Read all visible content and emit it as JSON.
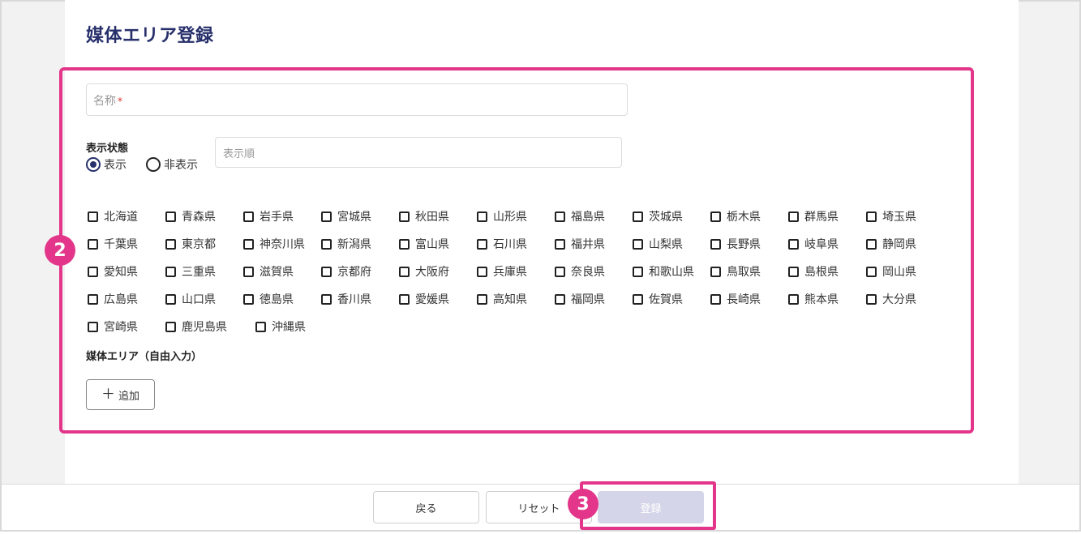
{
  "page": {
    "title": "媒体エリア登録"
  },
  "form": {
    "name_placeholder": "名称",
    "required_mark": "*",
    "status_label": "表示状態",
    "status_options": [
      "表示",
      "非表示"
    ],
    "status_selected": "表示",
    "order_placeholder": "表示順",
    "prefecture_rows": [
      [
        "北海道",
        "青森県",
        "岩手県",
        "宮城県",
        "秋田県",
        "山形県",
        "福島県",
        "茨城県",
        "栃木県",
        "群馬県",
        "埼玉県"
      ],
      [
        "千葉県",
        "東京都",
        "神奈川県",
        "新潟県",
        "富山県",
        "石川県",
        "福井県",
        "山梨県",
        "長野県",
        "岐阜県",
        "静岡県"
      ],
      [
        "愛知県",
        "三重県",
        "滋賀県",
        "京都府",
        "大阪府",
        "兵庫県",
        "奈良県",
        "和歌山県",
        "鳥取県",
        "島根県",
        "岡山県"
      ],
      [
        "広島県",
        "山口県",
        "徳島県",
        "香川県",
        "愛媛県",
        "高知県",
        "福岡県",
        "佐賀県",
        "長崎県",
        "熊本県",
        "大分県"
      ],
      [
        "宮崎県",
        "鹿児島県",
        "沖縄県"
      ]
    ],
    "free_input_label": "媒体エリア（自由入力）",
    "add_button_label": "追加",
    "add_icon": "plus-icon"
  },
  "footer": {
    "back_label": "戻る",
    "reset_label": "リセット",
    "submit_label": "登録"
  },
  "annotations": {
    "badge_2": "2",
    "badge_3": "3"
  },
  "colors": {
    "title": "#27306b",
    "highlight": "#e3368a",
    "submit_disabled": "#d4d5e8"
  }
}
